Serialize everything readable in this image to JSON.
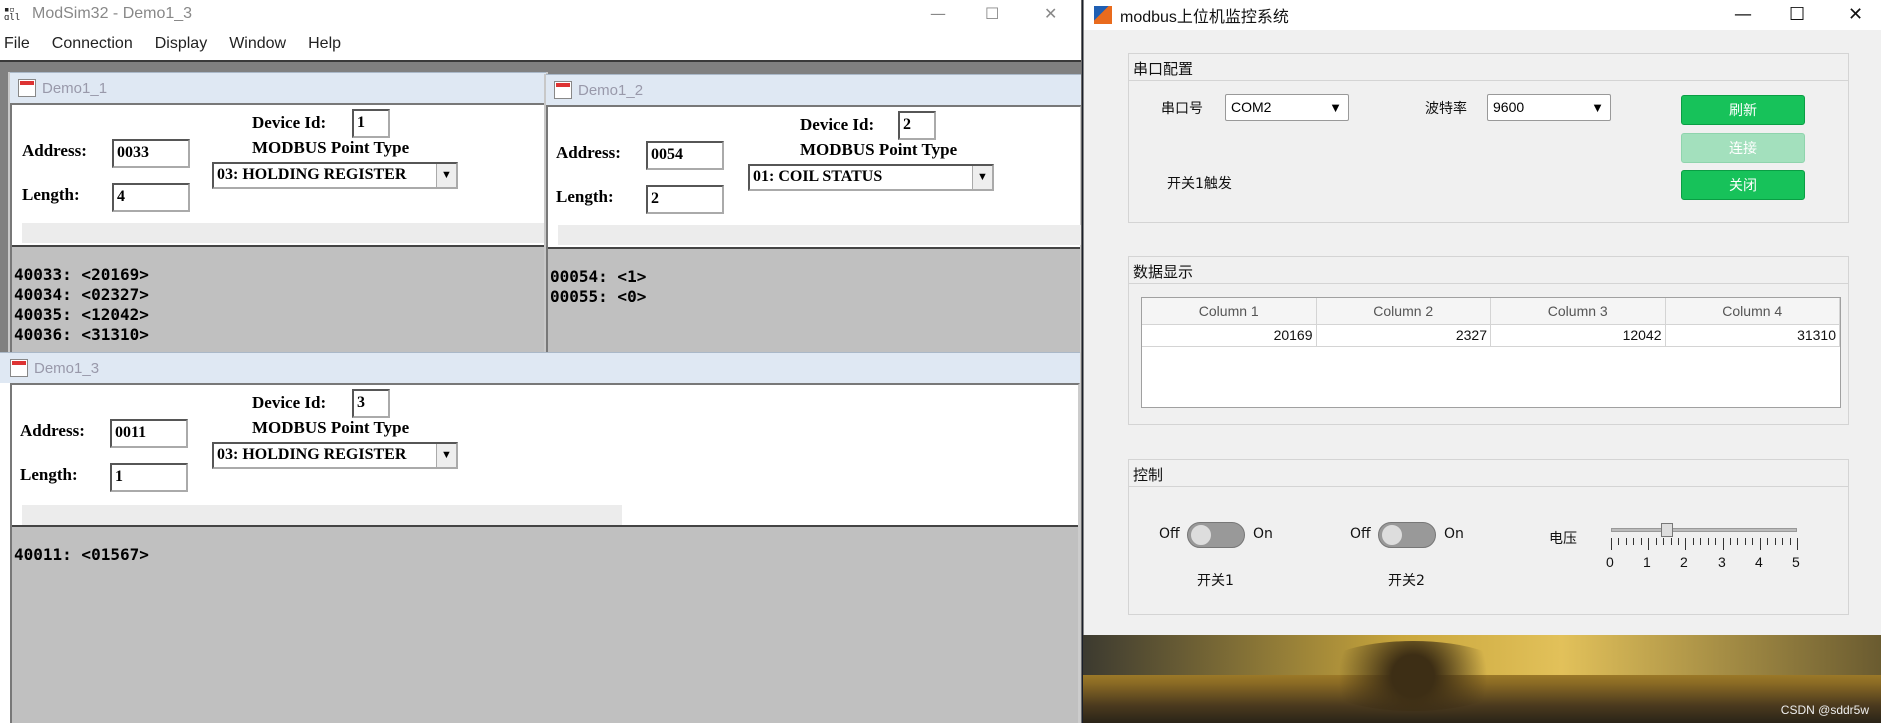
{
  "modsim": {
    "title": "ModSim32 - Demo1_3",
    "logo": "MODSIM",
    "menu": [
      "File",
      "Connection",
      "Display",
      "Window",
      "Help"
    ],
    "labels": {
      "device_id": "Device Id:",
      "address": "Address:",
      "length": "Length:",
      "point_type": "MODBUS Point Type"
    },
    "windows": [
      {
        "title": "Demo1_1",
        "device_id": "1",
        "address": "0033",
        "length": "4",
        "point_type": "03: HOLDING REGISTER",
        "data": "40033: <20169>\n40034: <02327>\n40035: <12042>\n40036: <31310>"
      },
      {
        "title": "Demo1_2",
        "device_id": "2",
        "address": "0054",
        "length": "2",
        "point_type": "01: COIL STATUS",
        "data": "00054: <1>\n00055: <0>"
      },
      {
        "title": "Demo1_3",
        "device_id": "3",
        "address": "0011",
        "length": "1",
        "point_type": "03: HOLDING REGISTER",
        "data": "40011: <01567>"
      }
    ]
  },
  "mb": {
    "title": "modbus上位机监控系统",
    "serial": {
      "title": "串口配置",
      "port_label": "串口号",
      "port_value": "COM2",
      "baud_label": "波特率",
      "baud_value": "9600",
      "refresh": "刷新",
      "connect": "连接",
      "close": "关闭",
      "trigger_label": "开关1触发"
    },
    "display": {
      "title": "数据显示",
      "columns": [
        "Column 1",
        "Column 2",
        "Column 3",
        "Column 4"
      ],
      "row": [
        "20169",
        "2327",
        "12042",
        "31310"
      ]
    },
    "control": {
      "title": "控制",
      "switch1": {
        "off": "Off",
        "on": "On",
        "label": "开关1",
        "state": "off"
      },
      "switch2": {
        "off": "Off",
        "on": "On",
        "label": "开关2",
        "state": "off"
      },
      "voltage_label": "电压",
      "voltage_value": 1.5,
      "voltage_ticks": [
        "0",
        "1",
        "2",
        "3",
        "4",
        "5"
      ]
    }
  },
  "watermark": "CSDN @sddr5w",
  "colors": {
    "green": "#17c25a",
    "green_disabled": "#a3e0bd"
  }
}
